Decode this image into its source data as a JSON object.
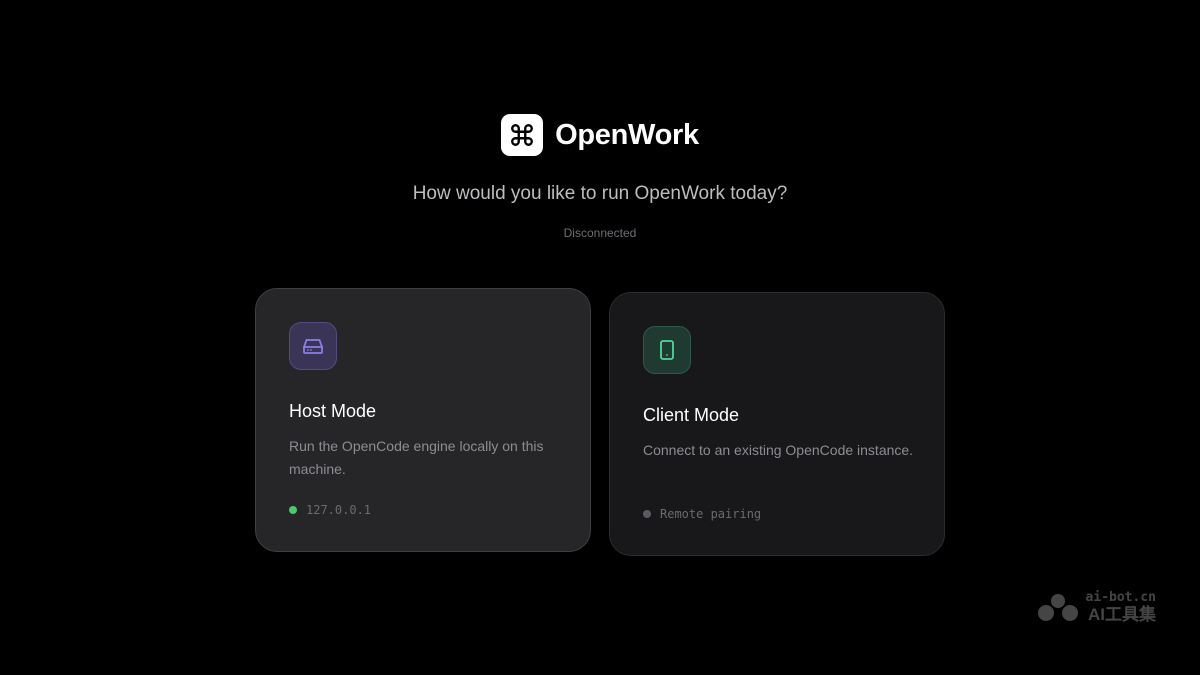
{
  "brand": {
    "name": "OpenWork",
    "logo_icon": "command-icon"
  },
  "prompt": "How would you like to run OpenWork today?",
  "connection_status": "Disconnected",
  "cards": [
    {
      "title": "Host Mode",
      "description": "Run the OpenCode engine locally on this machine.",
      "footer": "127.0.0.1",
      "icon": "hard-drive-icon",
      "accent_color": "#8b7fe8",
      "dot_color": "#4cc96a"
    },
    {
      "title": "Client Mode",
      "description": "Connect to an existing OpenCode instance.",
      "footer": "Remote pairing",
      "icon": "tablet-icon",
      "accent_color": "#4fd69c",
      "dot_color": "#5a5a60"
    }
  ],
  "watermark": {
    "top": "ai-bot.cn",
    "bottom": "AI工具集"
  }
}
